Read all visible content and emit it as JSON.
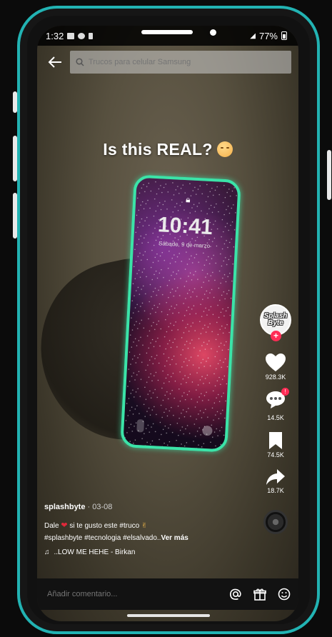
{
  "status_bar": {
    "time": "1:32",
    "battery": "77%"
  },
  "search": {
    "placeholder": "Trucos para celular Samsung"
  },
  "video": {
    "caption": "Is this REAL?",
    "lock_time": "10:41",
    "lock_date": "Sábado, 9 de marzo"
  },
  "creator": {
    "avatar_text_1": "Splash",
    "avatar_text_2": "Byte"
  },
  "actions": {
    "likes": "928.3K",
    "comments": "14.5K",
    "saves": "74.5K",
    "shares": "18.7K"
  },
  "post": {
    "username": "splashbyte",
    "date": "· 03-08",
    "line1_pre": "Dale",
    "line1_post": "si te gusto este #truco",
    "line2": "#splashbyte #tecnologia #elsalvado..",
    "more": "Ver más",
    "music": "..LOW ME HEHE - Birkan"
  },
  "comment_bar": {
    "placeholder": "Añadir comentario..."
  },
  "colors": {
    "frame": "#22b3b3",
    "like_red": "#ff2c55",
    "phone_glow": "#3be3a8"
  }
}
